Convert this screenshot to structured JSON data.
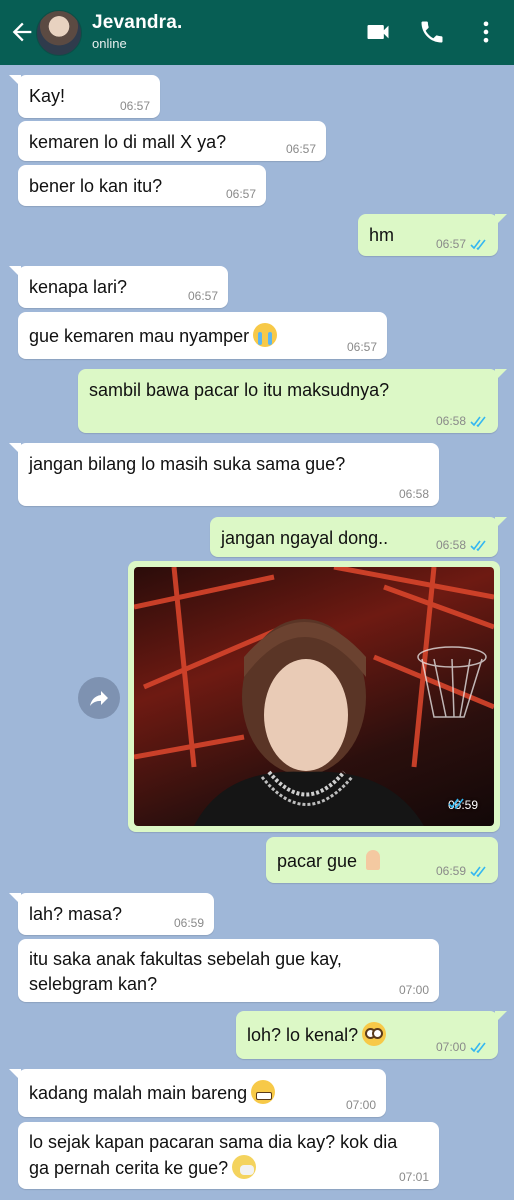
{
  "header": {
    "contact_name": "Jevandra.",
    "status": "online",
    "icons": [
      "back-arrow-icon",
      "video-call-icon",
      "phone-icon",
      "more-options-icon"
    ],
    "color": "#075e54"
  },
  "colors": {
    "incoming": "#ffffff",
    "outgoing": "#dcf8c6",
    "background": "#9fb7d8",
    "read_tick": "#34b7f1"
  },
  "messages": [
    {
      "dir": "in",
      "text": "Kay!",
      "time": "06:57"
    },
    {
      "dir": "in",
      "text": "kemaren lo di mall X ya?",
      "time": "06:57"
    },
    {
      "dir": "in",
      "text": "bener lo kan itu?",
      "time": "06:57"
    },
    {
      "dir": "out",
      "text": "hm",
      "time": "06:57"
    },
    {
      "dir": "in",
      "text": "kenapa lari?",
      "time": "06:57"
    },
    {
      "dir": "in",
      "text": "gue kemaren mau nyamper",
      "emoji": "loudly-crying-face",
      "time": "06:57"
    },
    {
      "dir": "out",
      "text": "sambil bawa pacar lo itu maksudnya?",
      "time": "06:58"
    },
    {
      "dir": "in",
      "text": "jangan bilang lo masih suka sama gue?",
      "time": "06:58"
    },
    {
      "dir": "out",
      "text": "jangan ngayal dong..",
      "time": "06:58"
    },
    {
      "dir": "out",
      "type": "photo",
      "time": "06:59"
    },
    {
      "dir": "out",
      "text": "pacar gue",
      "emoji": "folded-hands",
      "time": "06:59"
    },
    {
      "dir": "in",
      "text": "lah? masa?",
      "time": "06:59"
    },
    {
      "dir": "in",
      "text": "itu saka anak fakultas sebelah gue kay, selebgram kan?",
      "time": "07:00"
    },
    {
      "dir": "out",
      "text": "loh? lo kenal?",
      "emoji": "flushed-face",
      "time": "07:00"
    },
    {
      "dir": "in",
      "text": "kadang malah main bareng",
      "emoji": "grimacing-face",
      "time": "07:00"
    },
    {
      "dir": "in",
      "text": "lo sejak kapan pacaran sama dia kay? kok dia ga pernah cerita ke gue?",
      "emoji": "sneezing-face",
      "time": "07:01"
    }
  ]
}
